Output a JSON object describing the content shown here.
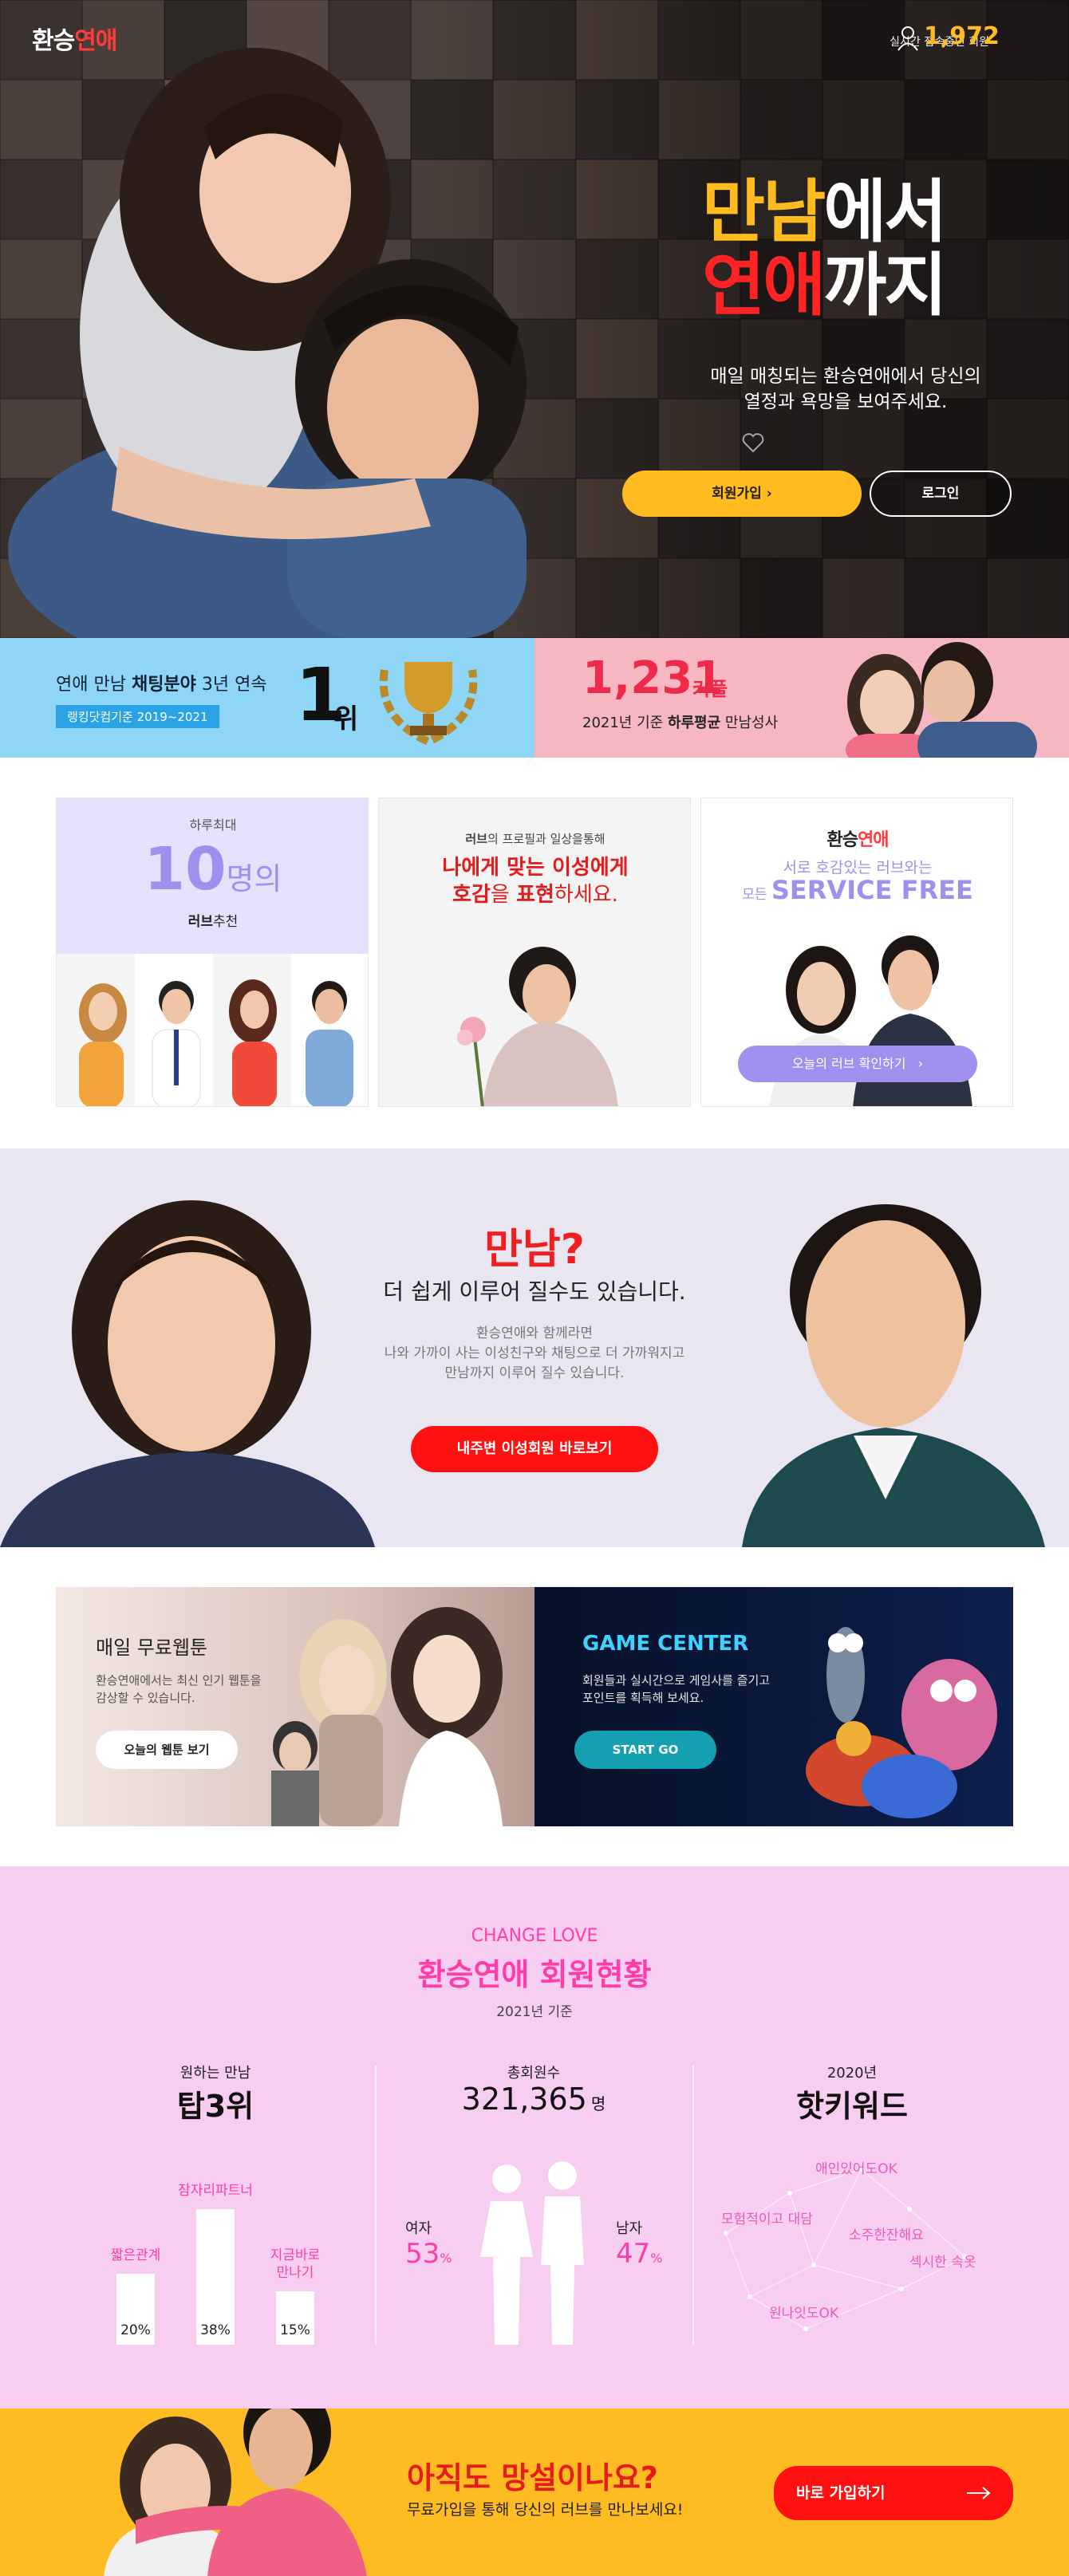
{
  "header": {
    "logo_part1": "환승",
    "logo_part2": "연애",
    "online_label": "실시간 접속중인 회원",
    "online_count": "1,972"
  },
  "hero": {
    "title_line1_a": "만남",
    "title_line1_b": "에서",
    "title_line2_a": "연애",
    "title_line2_b": "까지",
    "desc_line1": "매일 매칭되는 환승연애에서 당신의",
    "desc_line2": "열정과 욕망을 보여주세요.",
    "join_label": "회원가입",
    "login_label": "로그인"
  },
  "stats": {
    "left_text_a": "연애 만남 ",
    "left_text_b": "채팅분야",
    "left_text_c": " 3년 연속",
    "left_badge": "랭킹닷컴기준 2019~2021",
    "rank_num": "1",
    "rank_unit": "위",
    "couple_num": "1,231",
    "couple_unit": "커플",
    "couple_sub_a": "2021년 기준 ",
    "couple_sub_b": "하루평균",
    "couple_sub_c": " 만남성사"
  },
  "cards": {
    "c1_top": "하루최대",
    "c1_num": "10",
    "c1_unit": "명의",
    "c1_bottom_a": "러브",
    "c1_bottom_b": "추천",
    "c2_top_a": "러브",
    "c2_top_b": "의 프로필과 일상을통해",
    "c2_main1": "나에게 맞는 이성에게",
    "c2_main2_a": "호감",
    "c2_main2_b": "을 ",
    "c2_main2_c": "표현",
    "c2_main2_d": "하세요.",
    "c3_logo_a": "환승",
    "c3_logo_b": "연애",
    "c3_sub": "서로 호감있는 러브와는",
    "c3_free_a": "모든 ",
    "c3_free_b": "SERVICE FREE",
    "c3_btn": "오늘의 러브 확인하기"
  },
  "meet": {
    "title": "만남?",
    "subtitle": "더 쉽게 이루어 질수도 있습니다.",
    "p1": "환승연애와 함께라면",
    "p2": "나와 가까이 사는 이성친구와 채팅으로 더 가까워지고",
    "p3": "만남까지 이루어 질수 있습니다.",
    "btn": "내주변 이성회원 바로보기"
  },
  "promo": {
    "w_title": "매일 무료웹툰",
    "w_p1": "환승연애에서는 최신 인기 웹툰을",
    "w_p2": "감상할 수 있습니다.",
    "w_btn": "오늘의 웹툰 보기",
    "g_title": "GAME CENTER",
    "g_p1": "회원들과 실시간으로 게임사를 즐기고",
    "g_p2": "포인트를 획득해 보세요.",
    "g_btn": "START GO"
  },
  "status": {
    "eyebrow": "CHANGE LOVE",
    "title": "환승연애 회원현황",
    "year": "2021년 기준",
    "col1_label": "원하는 만남",
    "col1_value": "탑3위",
    "bars": [
      {
        "label": "짧은관계",
        "value": "20%",
        "pct": 20
      },
      {
        "label": "잠자리파트너",
        "value": "38%",
        "pct": 38
      },
      {
        "label": "지금바로 만나기",
        "value": "15%",
        "pct": 15
      }
    ],
    "col2_label": "총회원수",
    "col2_value": "321,365",
    "col2_unit": "명",
    "female_label": "여자",
    "female_pct": "53",
    "male_label": "남자",
    "male_pct": "47",
    "pct_sign": "%",
    "col3_label": "2020년",
    "col3_value": "핫키워드",
    "keywords": [
      "애인있어도OK",
      "모험적이고 대담",
      "소주한잔해요",
      "섹시한 속옷",
      "원나잇도OK"
    ]
  },
  "cta": {
    "title": "아직도 망설이나요?",
    "sub": "무료가입을 통해 당신의 러브를 만나보세요!",
    "btn": "바로 가입하기"
  },
  "colors": {
    "accent": "#ffb11b",
    "red": "#ff1a1a",
    "pink": "#ff3da8",
    "purple": "#9f90f0",
    "teal": "#14a0b0"
  }
}
